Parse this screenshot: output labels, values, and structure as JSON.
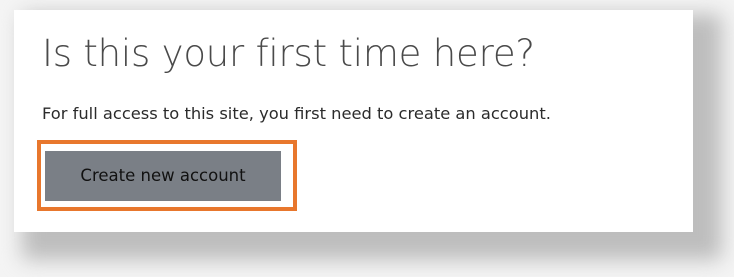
{
  "signup": {
    "heading": "Is this your first time here?",
    "info": "For full access to this site, you first need to create an account.",
    "create_account_label": "Create new account"
  },
  "colors": {
    "highlight": "#e8772d",
    "button_bg": "#7a7f86",
    "heading_text": "#4a4a4a"
  }
}
